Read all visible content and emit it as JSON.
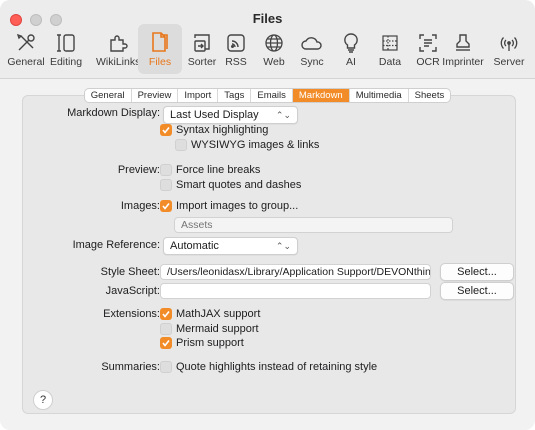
{
  "window": {
    "title": "Files"
  },
  "toolbar": {
    "items": [
      {
        "label": "General",
        "icon": "wrench-screwdriver-icon"
      },
      {
        "label": "Editing",
        "icon": "editing-icon"
      },
      {
        "label": "WikiLinks",
        "icon": "puzzle-icon"
      },
      {
        "label": "Files",
        "icon": "files-icon"
      },
      {
        "label": "Sorter",
        "icon": "sorter-icon"
      },
      {
        "label": "RSS",
        "icon": "rss-icon"
      },
      {
        "label": "Web",
        "icon": "globe-icon"
      },
      {
        "label": "Sync",
        "icon": "cloud-icon"
      },
      {
        "label": "AI",
        "icon": "lightbulb-icon"
      },
      {
        "label": "Data",
        "icon": "data-icon"
      },
      {
        "label": "OCR",
        "icon": "ocr-icon"
      },
      {
        "label": "Imprinter",
        "icon": "stamp-icon"
      },
      {
        "label": "Server",
        "icon": "broadcast-icon"
      }
    ],
    "selected": "Files",
    "accent": "#e8771b"
  },
  "tabs": [
    "General",
    "Preview",
    "Import",
    "Tags",
    "Emails",
    "Markdown",
    "Multimedia",
    "Sheets"
  ],
  "selected_tab": "Markdown",
  "form": {
    "markdown_display": {
      "label": "Markdown Display:",
      "value": "Last Used Display"
    },
    "syntax_highlighting": {
      "label": "Syntax highlighting",
      "checked": true
    },
    "wysiwyg": {
      "label": "WYSIWYG images & links",
      "checked": false
    },
    "preview": {
      "label": "Preview:"
    },
    "force_line_breaks": {
      "label": "Force line breaks",
      "checked": false
    },
    "smart_quotes": {
      "label": "Smart quotes and dashes",
      "checked": false
    },
    "images": {
      "label": "Images:"
    },
    "import_images": {
      "label": "Import images to group...",
      "checked": true
    },
    "assets": {
      "placeholder": "Assets"
    },
    "image_reference": {
      "label": "Image Reference:",
      "value": "Automatic"
    },
    "style_sheet": {
      "label": "Style Sheet:",
      "value": "/Users/leonidasx/Library/Application Support/DEVONthink/Style"
    },
    "javascript": {
      "label": "JavaScript:",
      "value": ""
    },
    "select_button": "Select...",
    "extensions": {
      "label": "Extensions:"
    },
    "mathjax": {
      "label": "MathJAX support",
      "checked": true
    },
    "mermaid": {
      "label": "Mermaid support",
      "checked": false
    },
    "prism": {
      "label": "Prism support",
      "checked": true
    },
    "summaries": {
      "label": "Summaries:"
    },
    "quote_highlights": {
      "label": "Quote highlights instead of retaining style",
      "checked": false
    }
  },
  "help_label": "?"
}
